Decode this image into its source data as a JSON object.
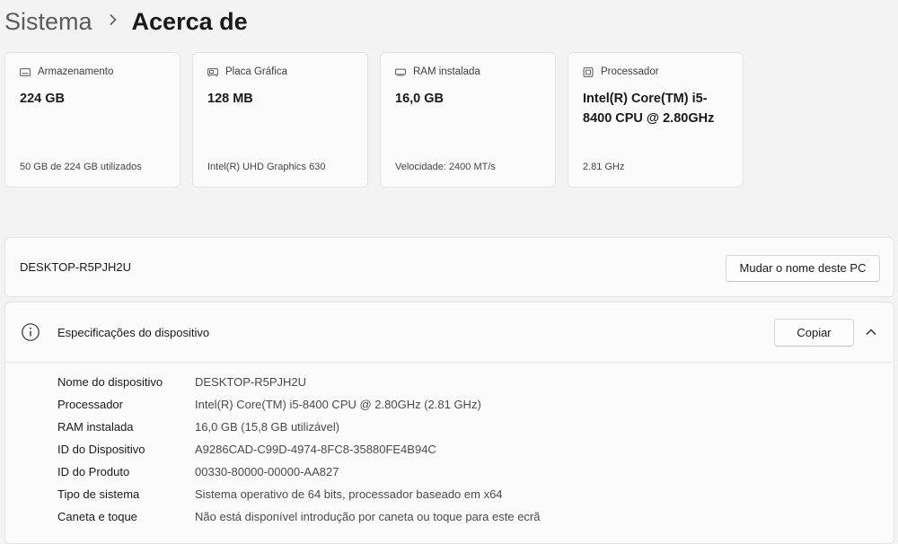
{
  "breadcrumb": {
    "parent": "Sistema",
    "separator_icon": "chevron-right-icon",
    "current": "Acerca de"
  },
  "cards": [
    {
      "icon": "storage-drive-icon",
      "title": "Armazenamento",
      "value": "224 GB",
      "sub": "50 GB de 224 GB utilizados"
    },
    {
      "icon": "graphics-card-icon",
      "title": "Placa Gráfica",
      "value": "128 MB",
      "sub": "Intel(R) UHD Graphics 630"
    },
    {
      "icon": "ram-chip-icon",
      "title": "RAM instalada",
      "value": "16,0 GB",
      "sub": "Velocidade: 2400 MT/s"
    },
    {
      "icon": "processor-icon",
      "title": "Processador",
      "value": "Intel(R) Core(TM) i5-8400 CPU @ 2.80GHz",
      "sub": "2.81 GHz"
    }
  ],
  "pc": {
    "name": "DESKTOP-R5PJH2U",
    "rename_label": "Mudar o nome deste PC"
  },
  "specs": {
    "title": "Especificações do dispositivo",
    "copy_label": "Copiar",
    "rows": [
      {
        "label": "Nome do dispositivo",
        "value": "DESKTOP-R5PJH2U"
      },
      {
        "label": "Processador",
        "value": "Intel(R) Core(TM) i5-8400 CPU @ 2.80GHz (2.81 GHz)"
      },
      {
        "label": "RAM instalada",
        "value": "16,0 GB (15,8 GB utilizável)"
      },
      {
        "label": "ID do Dispositivo",
        "value": "A9286CAD-C99D-4974-8FC8-35880FE4B94C"
      },
      {
        "label": "ID do Produto",
        "value": "00330-80000-00000-AA827"
      },
      {
        "label": "Tipo de sistema",
        "value": "Sistema operativo de 64 bits, processador baseado em x64"
      },
      {
        "label": "Caneta e toque",
        "value": "Não está disponível introdução por caneta ou toque para este ecrã"
      }
    ]
  }
}
